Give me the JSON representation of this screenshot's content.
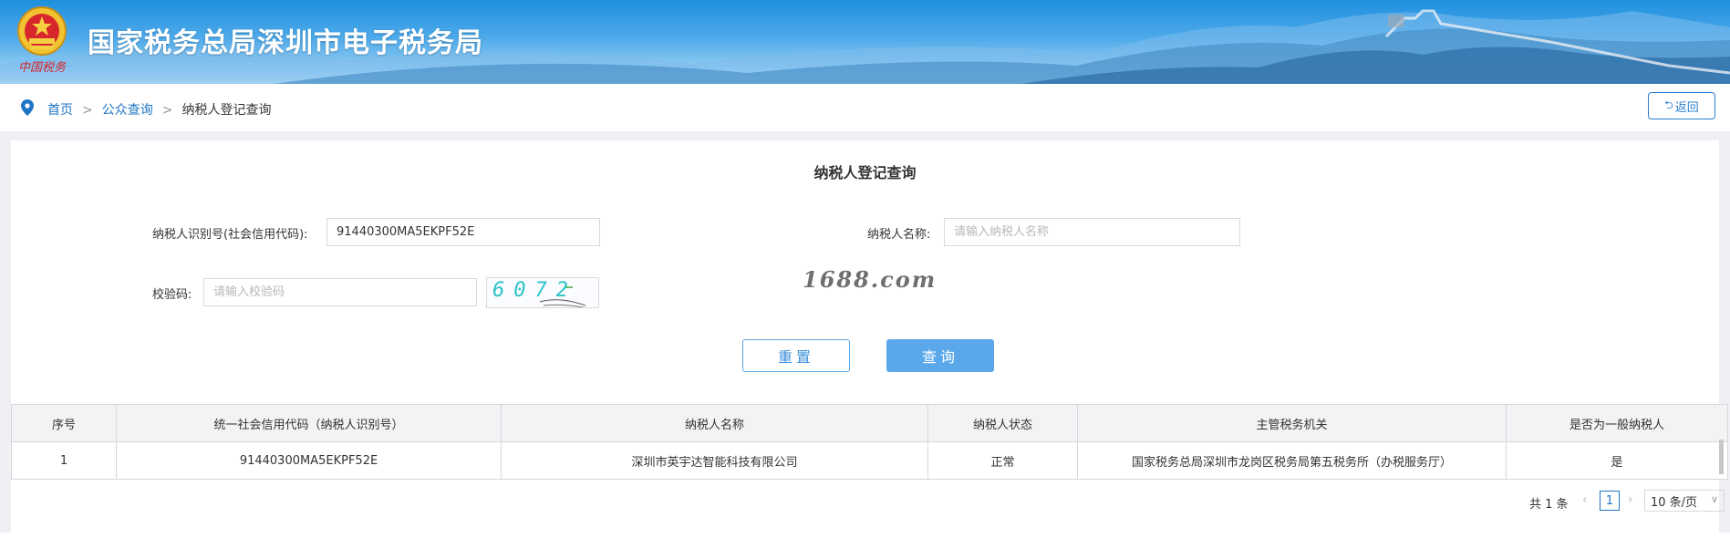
{
  "banner": {
    "title": "国家税务总局深圳市电子税务局",
    "emblem_caption": "中国税务"
  },
  "breadcrumb": {
    "items": [
      "首页",
      "公众查询"
    ],
    "separator": ">",
    "current": "纳税人登记查询"
  },
  "back_button": {
    "label": "返回",
    "icon": "return-icon"
  },
  "page_title": "纳税人登记查询",
  "form": {
    "taxpayer_id_label": "纳税人识别号(社会信用代码):",
    "taxpayer_id_value": "91440300MA5EKPF52E",
    "taxpayer_name_label": "纳税人名称:",
    "taxpayer_name_placeholder": "请输入纳税人名称",
    "captcha_label": "校验码:",
    "captcha_placeholder": "请输入校验码",
    "captcha_image_text": "6072"
  },
  "watermark": "1688.com",
  "buttons": {
    "reset": "重置",
    "query": "查询"
  },
  "table": {
    "headers": [
      "序号",
      "统一社会信用代码（纳税人识别号）",
      "纳税人名称",
      "纳税人状态",
      "主管税务机关",
      "是否为一般纳税人"
    ],
    "rows": [
      [
        "1",
        "91440300MA5EKPF52E",
        "深圳市英宇达智能科技有限公司",
        "正常",
        "国家税务总局深圳市龙岗区税务局第五税务所（办税服务厅）",
        "是"
      ]
    ]
  },
  "pagination": {
    "total_text": "共 1 条",
    "current_page": "1",
    "page_size": "10 条/页"
  },
  "colors": {
    "accent": "#1f75c4",
    "query_button": "#5aa8ea",
    "banner_top": "#1f8fde"
  }
}
